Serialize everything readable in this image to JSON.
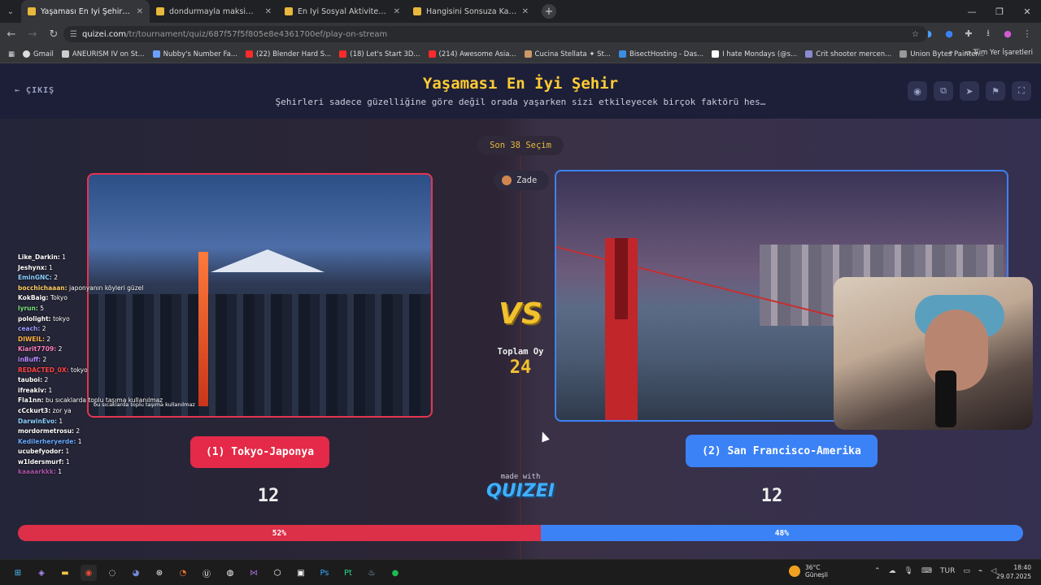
{
  "browser": {
    "tabs": [
      {
        "title": "Yaşaması En İyi Şehir - Quizei",
        "active": true
      },
      {
        "title": "dondurmayla maksimum saran",
        "active": false
      },
      {
        "title": "En İyi Sosyal Aktivite - Quizei",
        "active": false
      },
      {
        "title": "Hangisini Sonsuza Kadar Yasakl",
        "active": false
      }
    ],
    "url_host": "quizei.com",
    "url_path": "/tr/tournament/quiz/687f57f5f805e8e4361700ef/play-on-stream",
    "bookmarks": [
      "Gmail",
      "ANEURISM IV on St...",
      "Nubby's Number Fa...",
      "(22) Blender Hard S...",
      "(18) Let's Start 3D...",
      "(214) Awesome Asia...",
      "Cucina Stellata ✦ St...",
      "BisectHosting - Das...",
      "I hate Mondays (@s...",
      "Crit shooter mercen...",
      "Union Bytes Painter..."
    ],
    "bookmarks_more": "»",
    "all_bookmarks": "Tüm Yer İşaretleri"
  },
  "page": {
    "exit_label": "ÇIKIŞ",
    "title": "Yaşaması En İyi Şehir",
    "subtitle": "Şehirleri sadece güzelliğine göre değil orada yaşarken sizi etkileyecek birçok faktörü hes…",
    "last_choices": "Son 38 Seçim",
    "user": "Zade",
    "vs": "VS",
    "total_label": "Toplam Oy",
    "total_value": "24",
    "made_with": "made with",
    "brand": "QUIZEI",
    "left": {
      "label": "(1) Tokyo-Japonya",
      "votes": "12",
      "percent": "52%",
      "fraction": 0.52,
      "image_caption": "bu sıcaklarda toplu taşıma kullanılmaz"
    },
    "right": {
      "label": "(2) San Francisco-Amerika",
      "votes": "12",
      "percent": "48%"
    }
  },
  "chat": [
    {
      "user": "Like_Darkin:",
      "msg": "1",
      "color": "#ffffff"
    },
    {
      "user": "Jeshynx:",
      "msg": "1",
      "color": "#ffffff"
    },
    {
      "user": "EminGNC:",
      "msg": "2",
      "color": "#8ad0ff"
    },
    {
      "user": "bocchichaaan:",
      "msg": "japonyanın köyleri güzel",
      "color": "#ffcc66"
    },
    {
      "user": "KokBaig:",
      "msg": "Tokyo",
      "color": "#ffffff"
    },
    {
      "user": "lyrun:",
      "msg": "5",
      "color": "#7fe37f"
    },
    {
      "user": "pololight:",
      "msg": "tokyo",
      "color": "#ffffff"
    },
    {
      "user": "ceach:",
      "msg": "2",
      "color": "#9a9aff"
    },
    {
      "user": "DIWEIL:",
      "msg": "2",
      "color": "#ffb347"
    },
    {
      "user": "Kiarit7709:",
      "msg": "2",
      "color": "#ff7fbf"
    },
    {
      "user": "inBuff:",
      "msg": "2",
      "color": "#bb88ff"
    },
    {
      "user": "REDACTED_0X:",
      "msg": "tokyo",
      "color": "#ff4444"
    },
    {
      "user": "tauboi:",
      "msg": "2",
      "color": "#ffffff"
    },
    {
      "user": "ifreakiv:",
      "msg": "1",
      "color": "#ffffff"
    },
    {
      "user": "Fla1nn:",
      "msg": "bu sıcaklarda toplu taşıma kullanılmaz",
      "color": "#ffffff"
    },
    {
      "user": "cCckurt3:",
      "msg": "zor ya",
      "color": "#ffffff"
    },
    {
      "user": "DarwinEvo:",
      "msg": "1",
      "color": "#8ad0ff"
    },
    {
      "user": "mordormetrosu:",
      "msg": "2",
      "color": "#ffffff"
    },
    {
      "user": "Kedilerheryerde:",
      "msg": "1",
      "color": "#66aaff"
    },
    {
      "user": "ucubefyodor:",
      "msg": "1",
      "color": "#ffffff"
    },
    {
      "user": "w1ldersmurf:",
      "msg": "1",
      "color": "#ffffff"
    },
    {
      "user": "kaaaarkkk:",
      "msg": "1",
      "color": "#aa55aa"
    }
  ],
  "taskbar": {
    "temperature": "36°C",
    "weather": "Güneşli",
    "lang": "TUR",
    "time": "18:40",
    "date": "29.07.2025"
  }
}
